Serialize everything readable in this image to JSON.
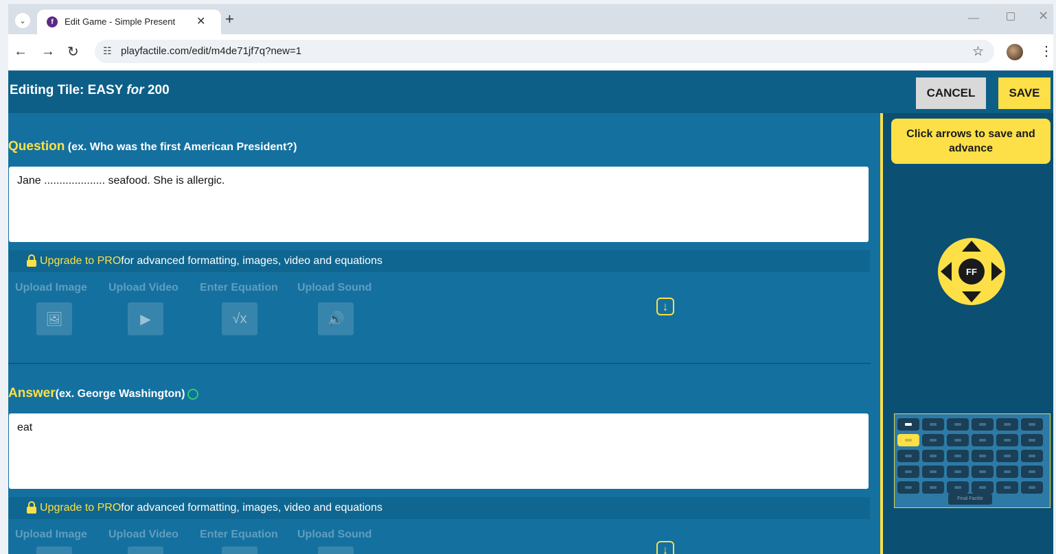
{
  "browser": {
    "tab_title": "Edit Game - Simple Present",
    "url": "playfactile.com/edit/m4de71jf7q?new=1"
  },
  "header": {
    "title_prefix": "Editing Tile: EASY ",
    "title_for": "for",
    "title_value": " 200",
    "cancel_label": "CANCEL",
    "save_label": "SAVE"
  },
  "question": {
    "label": "Question",
    "hint": " (ex. Who was the first American President?)",
    "text": "Jane .................... seafood. She is allergic."
  },
  "answer": {
    "label": "Answer",
    "hint": "(ex. George Washington)",
    "text": "eat"
  },
  "upgrade": {
    "link": "Upgrade to PRO",
    "text": "for advanced formatting, images, video and equations"
  },
  "media": {
    "upload_image": "Upload Image",
    "upload_video": "Upload Video",
    "enter_equation": "Enter Equation",
    "upload_sound": "Upload Sound"
  },
  "sidebar": {
    "tip": "Click arrows to save and advance",
    "logo": "FF"
  },
  "minimap": {
    "columns": 6,
    "rows": 5,
    "active_tile": "200",
    "final_label": "Final Factile"
  },
  "colors": {
    "app_bg": "#14709f",
    "header_bg": "#0d5f87",
    "accent_yellow": "#fde047",
    "sidebar_bg": "#0b4f73"
  }
}
